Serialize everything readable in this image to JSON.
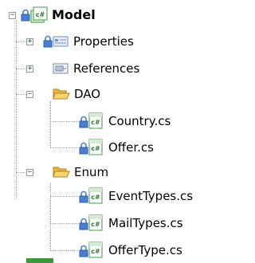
{
  "solution_tree": {
    "root": {
      "label": "Model",
      "expander": "−",
      "icons": [
        "lock-icon",
        "csharp-project-icon"
      ]
    },
    "items": [
      {
        "label": "Properties",
        "expander": "+",
        "icons": [
          "lock-icon",
          "properties-icon"
        ]
      },
      {
        "label": "References",
        "expander": "+",
        "icons": [
          "references-icon"
        ]
      },
      {
        "label": "DAO",
        "expander": "−",
        "icons": [
          "folder-open-icon"
        ]
      },
      {
        "label": "Country.cs",
        "icons": [
          "lock-icon",
          "csharp-file-icon"
        ]
      },
      {
        "label": "Offer.cs",
        "icons": [
          "lock-icon",
          "csharp-file-icon"
        ]
      },
      {
        "label": "Enum",
        "expander": "−",
        "icons": [
          "folder-open-icon"
        ]
      },
      {
        "label": "EventTypes.cs",
        "icons": [
          "lock-icon",
          "csharp-file-icon"
        ]
      },
      {
        "label": "MailTypes.cs",
        "icons": [
          "lock-icon",
          "csharp-file-icon"
        ]
      },
      {
        "label": "OfferType.cs",
        "icons": [
          "lock-icon",
          "csharp-file-icon"
        ]
      }
    ]
  },
  "colors": {
    "folder": "#f5c84c",
    "csharp_icon": "#3d9b3d",
    "lock": "#4a7fd6",
    "tree_lines": "#a0a0a0"
  }
}
